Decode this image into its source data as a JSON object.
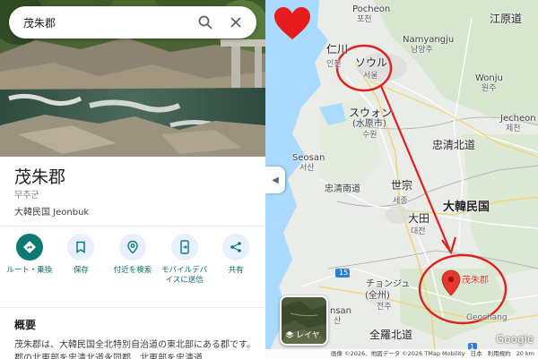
{
  "search": {
    "query": "茂朱郡"
  },
  "place": {
    "title": "茂朱郡",
    "korean_name": "무주군",
    "region": "大韓民国 Jeonbuk"
  },
  "actions": [
    {
      "label": "ルート・乗換",
      "icon": "directions-icon"
    },
    {
      "label": "保存",
      "icon": "bookmark-icon"
    },
    {
      "label": "付近を検索",
      "icon": "nearby-search-icon"
    },
    {
      "label": "モバイルデバイスに送信",
      "icon": "send-to-phone-icon"
    },
    {
      "label": "共有",
      "icon": "share-icon"
    }
  ],
  "overview": {
    "heading": "概要",
    "text": "茂朱郡は、大韓民国全北特別自治道の東北部にある郡です。郡の北東部を忠清北道永同郡、北東部を忠清道"
  },
  "map": {
    "labels": {
      "pocheon": "Pocheon",
      "pocheon_ko": "포천",
      "namyangju": "Namyangju",
      "namyangju_ko": "남양주",
      "incheon": "仁川",
      "incheon_ko": "인천",
      "seoul": "ソウル",
      "seoul_ko": "서울",
      "gangwon": "江原道",
      "wonju": "Wonju",
      "wonju_ko": "원주",
      "jecheon": "Jecheon",
      "jecheon_ko": "제천",
      "suwon": "スウォン",
      "suwon_han": "(水原市)",
      "suwon_ko": "수원",
      "chungbuk": "忠清北道",
      "seosan": "Seosan",
      "seosan_ko": "서산",
      "chungnam": "忠清南道",
      "sejong": "世宗",
      "sejong_ko": "세종",
      "daejeon": "大田",
      "daejeon_ko": "대전",
      "korea": "大韓民国",
      "muju": "茂朱郡",
      "jeonju": "チョンジュ",
      "jeonju_han": "(全州)",
      "jeonju_ko": "전주",
      "jeolla": "全羅北道",
      "gunsan": "nsan",
      "gunsan_ko": "산",
      "geochang": "Geochang",
      "road_1": "1",
      "road_151": "151"
    },
    "layer_label": "レイヤ",
    "google": "Google",
    "attribution": [
      "画像 ©2026、地図データ ©2026 TMap Mobility",
      "日本",
      "利用規約",
      "20 km"
    ]
  },
  "colors": {
    "accent": "#0b7a75",
    "annotation_red": "#e0201b",
    "pin_red": "#e23a2e"
  }
}
